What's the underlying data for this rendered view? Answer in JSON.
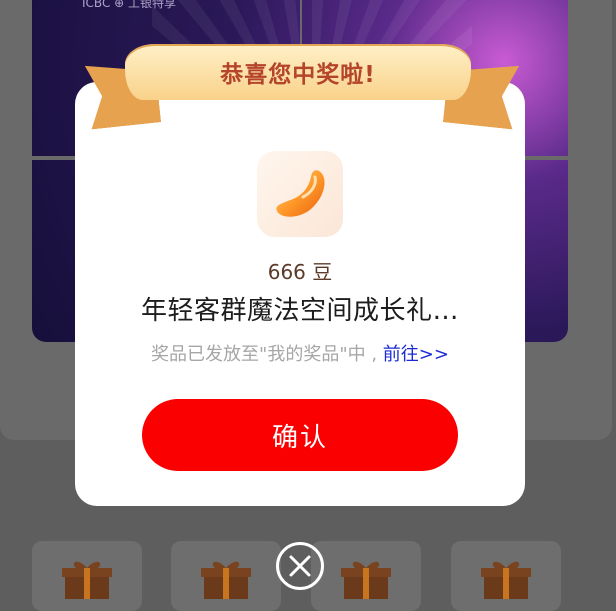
{
  "background": {
    "banner_logo": "ICBC ⊕ 工银特享",
    "gift_icon": "gift-box-icon"
  },
  "modal": {
    "title": "恭喜您中奖啦!",
    "prize_icon": "bean-icon",
    "amount": "666 豆",
    "prize_name": "年轻客群魔法空间成长礼…",
    "note_prefix": "奖品已发放至\"我的奖品\"中 , ",
    "note_link": "前往>>",
    "confirm_label": "确认",
    "close_icon": "close-circle-icon"
  },
  "colors": {
    "confirm": "#fa0000",
    "title": "#b5452a",
    "link": "#1c2ad6",
    "ribbon": "#f9d28a"
  }
}
